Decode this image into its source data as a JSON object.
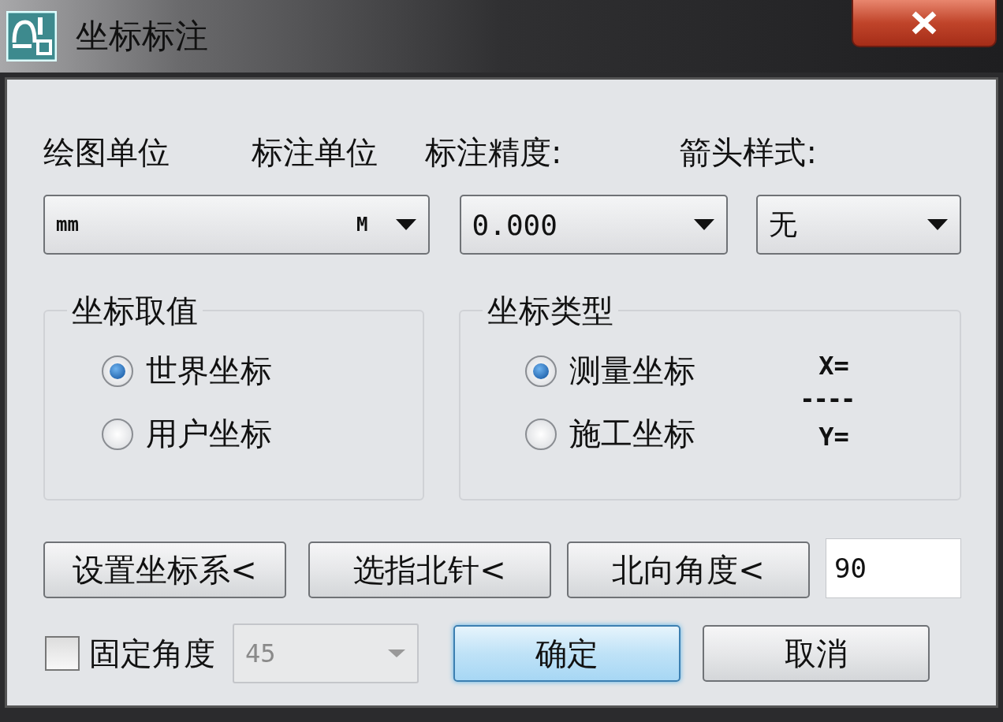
{
  "window": {
    "title": "坐标标注"
  },
  "units": {
    "drawing_label": "绘图单位",
    "annotation_label": "标注单位",
    "drawing_value": "mm",
    "annotation_value": "M"
  },
  "precision": {
    "label": "标注精度:",
    "value": "0.000"
  },
  "arrow_style": {
    "label": "箭头样式:",
    "value": "无"
  },
  "coordinate_source": {
    "title": "坐标取值",
    "options": [
      {
        "label": "世界坐标",
        "selected": true
      },
      {
        "label": "用户坐标",
        "selected": false
      }
    ]
  },
  "coordinate_type": {
    "title": "坐标类型",
    "options": [
      {
        "label": "测量坐标",
        "selected": true
      },
      {
        "label": "施工坐标",
        "selected": false
      }
    ],
    "preview": {
      "x_label": "X=",
      "divider": "----",
      "y_label": "Y="
    }
  },
  "buttons": [
    {
      "label": "设置坐标系<"
    },
    {
      "label": "选指北针<"
    },
    {
      "label": "北向角度<"
    }
  ],
  "north_angle": {
    "value": "90"
  },
  "fixed_angle": {
    "label": "固定角度",
    "checked": false,
    "value": "45",
    "disabled": true
  },
  "actions": [
    {
      "label": "确定",
      "default": true
    },
    {
      "label": "取消",
      "default": false
    }
  ]
}
